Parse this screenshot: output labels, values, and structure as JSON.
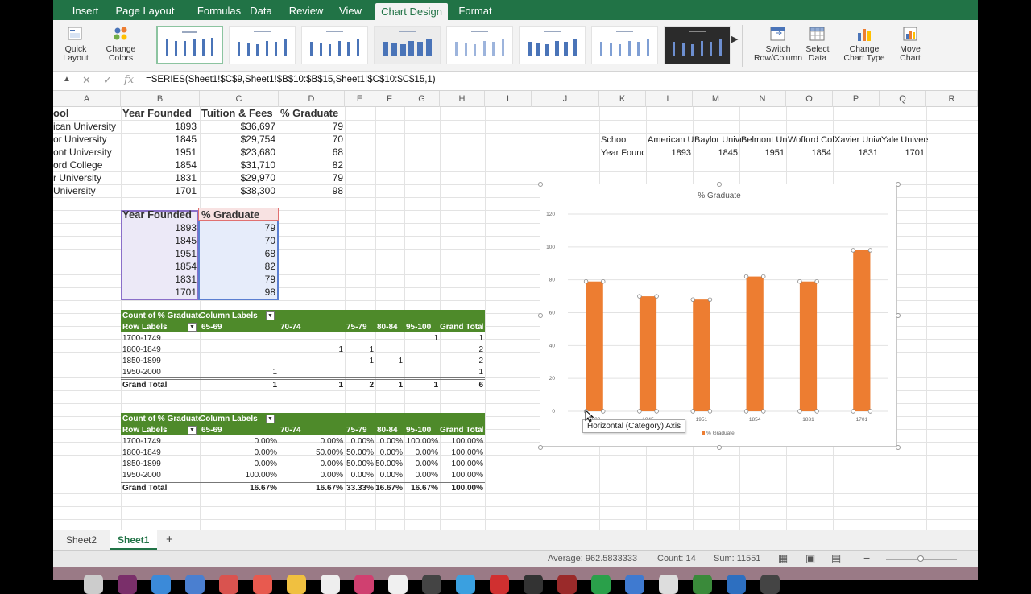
{
  "ribbon_tabs": [
    "Insert",
    "Page Layout",
    "Formulas",
    "Data",
    "Review",
    "View",
    "Chart Design",
    "Format"
  ],
  "active_tab": "Chart Design",
  "ribbon": {
    "quick_layout": "Quick Layout",
    "change_colors": "Change Colors",
    "switch_row_col": "Switch Row/Column",
    "select_data": "Select Data",
    "change_chart_type": "Change Chart Type",
    "move_chart": "Move Chart"
  },
  "formula_bar": {
    "formula": "=SERIES(Sheet1!$C$9,Sheet1!$B$10:$B$15,Sheet1!$C$10:$C$15,1)"
  },
  "columns": [
    "A",
    "B",
    "C",
    "D",
    "E",
    "F",
    "G",
    "H",
    "I",
    "J",
    "K",
    "L",
    "M",
    "N",
    "O",
    "P",
    "Q",
    "R"
  ],
  "main_table": {
    "headers": [
      "ool",
      "Year Founded",
      "Tuition & Fees",
      "% Graduate"
    ],
    "rows": [
      [
        "ican University",
        "1893",
        "$36,697",
        "79"
      ],
      [
        "or University",
        "1845",
        "$29,754",
        "70"
      ],
      [
        "ont University",
        "1951",
        "$23,680",
        "68"
      ],
      [
        "ord College",
        "1854",
        "$31,710",
        "82"
      ],
      [
        "r University",
        "1831",
        "$29,970",
        "79"
      ],
      [
        "University",
        "1701",
        "$38,300",
        "98"
      ]
    ]
  },
  "selected_table": {
    "headers": [
      "Year Founded",
      "% Graduate"
    ],
    "rows": [
      [
        "1893",
        "79"
      ],
      [
        "1845",
        "70"
      ],
      [
        "1951",
        "68"
      ],
      [
        "1854",
        "82"
      ],
      [
        "1831",
        "79"
      ],
      [
        "1701",
        "98"
      ]
    ]
  },
  "transposed": {
    "row1": [
      "School",
      "American Un",
      "Baylor Unive",
      "Belmont Uni",
      "Wofford Coll",
      "Xavier Unive",
      "Yale University"
    ],
    "row2": [
      "Year Founde",
      "1893",
      "1845",
      "1951",
      "1854",
      "1831",
      "1701"
    ]
  },
  "pivot1": {
    "title": "Count of % Graduate",
    "col_labels": "Column Labels",
    "row_labels": "Row Labels",
    "col_headers": [
      "65-69",
      "70-74",
      "75-79",
      "80-84",
      "95-100",
      "Grand Total"
    ],
    "rows": [
      {
        "label": "1700-1749",
        "vals": [
          "",
          "",
          "",
          "",
          "1",
          "1"
        ]
      },
      {
        "label": "1800-1849",
        "vals": [
          "",
          "1",
          "1",
          "",
          "",
          "2"
        ]
      },
      {
        "label": "1850-1899",
        "vals": [
          "",
          "",
          "1",
          "1",
          "",
          "2"
        ]
      },
      {
        "label": "1950-2000",
        "vals": [
          "1",
          "",
          "",
          "",
          "",
          "1"
        ]
      }
    ],
    "total": {
      "label": "Grand Total",
      "vals": [
        "1",
        "1",
        "2",
        "1",
        "1",
        "6"
      ]
    }
  },
  "pivot2": {
    "title": "Count of % Graduate",
    "col_labels": "Column Labels",
    "row_labels": "Row Labels",
    "col_headers": [
      "65-69",
      "70-74",
      "75-79",
      "80-84",
      "95-100",
      "Grand Total"
    ],
    "rows": [
      {
        "label": "1700-1749",
        "vals": [
          "0.00%",
          "0.00%",
          "0.00%",
          "0.00%",
          "100.00%",
          "100.00%"
        ]
      },
      {
        "label": "1800-1849",
        "vals": [
          "0.00%",
          "50.00%",
          "50.00%",
          "0.00%",
          "0.00%",
          "100.00%"
        ]
      },
      {
        "label": "1850-1899",
        "vals": [
          "0.00%",
          "0.00%",
          "50.00%",
          "50.00%",
          "0.00%",
          "100.00%"
        ]
      },
      {
        "label": "1950-2000",
        "vals": [
          "100.00%",
          "0.00%",
          "0.00%",
          "0.00%",
          "0.00%",
          "100.00%"
        ]
      }
    ],
    "total": {
      "label": "Grand Total",
      "vals": [
        "16.67%",
        "16.67%",
        "33.33%",
        "16.67%",
        "16.67%",
        "100.00%"
      ]
    }
  },
  "chart_data": {
    "type": "bar",
    "title": "% Graduate",
    "categories": [
      "1893",
      "1845",
      "1951",
      "1854",
      "1831",
      "1701"
    ],
    "series": [
      {
        "name": "% Graduate",
        "values": [
          79,
          70,
          68,
          82,
          79,
          98
        ]
      }
    ],
    "ylim": [
      0,
      120
    ],
    "yticks": [
      "0",
      "20",
      "40",
      "60",
      "80",
      "100",
      "120"
    ],
    "grid": true,
    "legend": "bottom",
    "bar_color": "#ED7D31"
  },
  "tooltip": "Horizontal (Category) Axis",
  "sheet_tabs": [
    "Sheet2",
    "Sheet1"
  ],
  "active_sheet": "Sheet1",
  "add_sheet": "+",
  "status": {
    "average": "Average: 962.5833333",
    "count": "Count: 14",
    "sum": "Sum: 11551"
  }
}
